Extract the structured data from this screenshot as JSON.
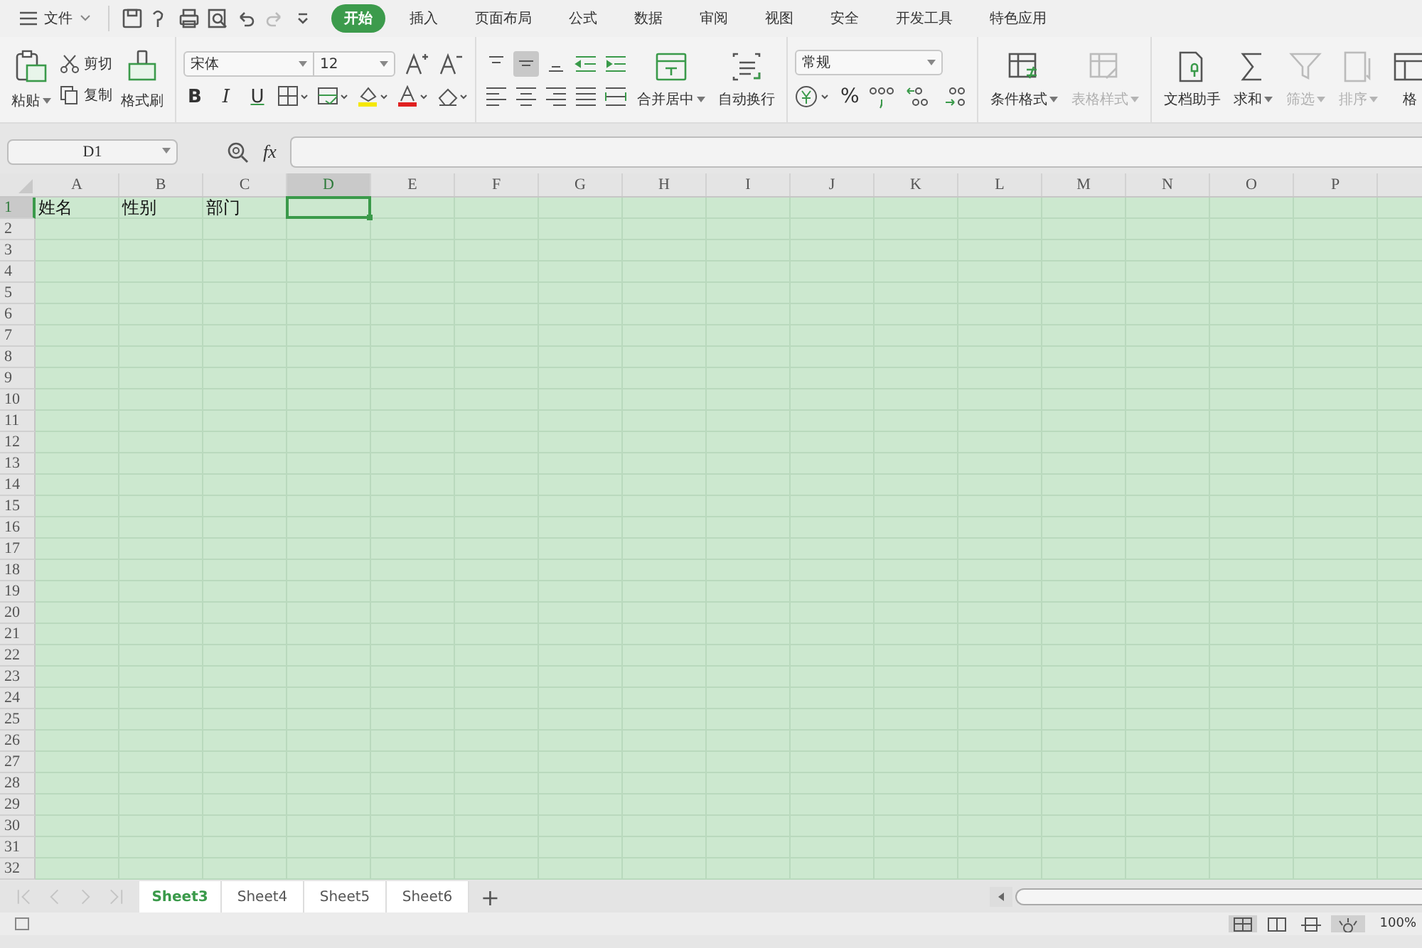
{
  "menu": {
    "file": "文件",
    "tabs": [
      {
        "label": "开始",
        "selected": true
      },
      {
        "label": "插入",
        "selected": false
      },
      {
        "label": "页面布局",
        "selected": false
      },
      {
        "label": "公式",
        "selected": false
      },
      {
        "label": "数据",
        "selected": false
      },
      {
        "label": "审阅",
        "selected": false
      },
      {
        "label": "视图",
        "selected": false
      },
      {
        "label": "安全",
        "selected": false
      },
      {
        "label": "开发工具",
        "selected": false
      },
      {
        "label": "特色应用",
        "selected": false
      }
    ]
  },
  "ribbon": {
    "paste": {
      "label": "粘贴",
      "has_menu": true
    },
    "cut": {
      "label": "剪切"
    },
    "copy": {
      "label": "复制"
    },
    "format_painter": {
      "label": "格式刷"
    },
    "font": {
      "value": "宋体"
    },
    "font_size": {
      "value": "12"
    },
    "text_styles": [
      "B",
      "I",
      "U"
    ],
    "merge_wrap": [
      {
        "label": "合并居中",
        "has_menu": true,
        "disabled": false
      },
      {
        "label": "自动换行",
        "has_menu": false,
        "disabled": false
      }
    ],
    "number_format": {
      "value": "常规"
    },
    "percent": "%",
    "styles": [
      {
        "label": "条件格式",
        "has_menu": true,
        "disabled": false
      },
      {
        "label": "表格样式",
        "has_menu": true,
        "disabled": true
      }
    ],
    "tools": [
      {
        "label": "文档助手",
        "has_menu": false,
        "disabled": false
      },
      {
        "label": "求和",
        "has_menu": true,
        "disabled": false
      },
      {
        "label": "筛选",
        "has_menu": true,
        "disabled": true
      },
      {
        "label": "排序",
        "has_menu": true,
        "disabled": true
      },
      {
        "label": "格",
        "has_menu": false,
        "disabled": false
      }
    ]
  },
  "formula_bar": {
    "name_box": "D1",
    "fx": "fx"
  },
  "columns": [
    {
      "label": "A",
      "selected": false
    },
    {
      "label": "B",
      "selected": false
    },
    {
      "label": "C",
      "selected": false
    },
    {
      "label": "D",
      "selected": true
    },
    {
      "label": "E",
      "selected": false
    },
    {
      "label": "F",
      "selected": false
    },
    {
      "label": "G",
      "selected": false
    },
    {
      "label": "H",
      "selected": false
    },
    {
      "label": "I",
      "selected": false
    },
    {
      "label": "J",
      "selected": false
    },
    {
      "label": "K",
      "selected": false
    },
    {
      "label": "L",
      "selected": false
    },
    {
      "label": "M",
      "selected": false
    },
    {
      "label": "N",
      "selected": false
    },
    {
      "label": "O",
      "selected": false
    },
    {
      "label": "P",
      "selected": false
    }
  ],
  "rows": [
    {
      "number": "1",
      "selected": true,
      "cells": [
        "姓名",
        "性别",
        "部门"
      ]
    },
    {
      "number": "2",
      "selected": false
    },
    {
      "number": "3",
      "selected": false
    },
    {
      "number": "4",
      "selected": false
    },
    {
      "number": "5",
      "selected": false
    },
    {
      "number": "6",
      "selected": false
    },
    {
      "number": "7",
      "selected": false
    },
    {
      "number": "8",
      "selected": false
    },
    {
      "number": "9",
      "selected": false
    },
    {
      "number": "10",
      "selected": false
    },
    {
      "number": "11",
      "selected": false
    },
    {
      "number": "12",
      "selected": false
    },
    {
      "number": "13",
      "selected": false
    },
    {
      "number": "14",
      "selected": false
    },
    {
      "number": "15",
      "selected": false
    },
    {
      "number": "16",
      "selected": false
    },
    {
      "number": "17",
      "selected": false
    },
    {
      "number": "18",
      "selected": false
    },
    {
      "number": "19",
      "selected": false
    },
    {
      "number": "20",
      "selected": false
    },
    {
      "number": "21",
      "selected": false
    },
    {
      "number": "22",
      "selected": false
    },
    {
      "number": "23",
      "selected": false
    },
    {
      "number": "24",
      "selected": false
    },
    {
      "number": "25",
      "selected": false
    },
    {
      "number": "26",
      "selected": false
    },
    {
      "number": "27",
      "selected": false
    },
    {
      "number": "28",
      "selected": false
    },
    {
      "number": "29",
      "selected": false
    },
    {
      "number": "30",
      "selected": false
    },
    {
      "number": "31",
      "selected": false
    },
    {
      "number": "32",
      "selected": false
    }
  ],
  "sheet_tabs": [
    {
      "label": "Sheet3",
      "selected": true
    },
    {
      "label": "Sheet4",
      "selected": false
    },
    {
      "label": "Sheet5",
      "selected": false
    },
    {
      "label": "Sheet6",
      "selected": false
    }
  ],
  "add_sheet": "+",
  "status_bar": {
    "zoom": "100%"
  }
}
